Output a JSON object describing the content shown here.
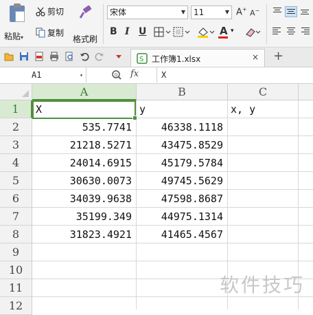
{
  "ribbon": {
    "paste_label": "粘贴",
    "cut_label": "剪切",
    "copy_label": "复制",
    "format_painter_label": "格式刷",
    "font_name": "宋体",
    "font_size": "11",
    "bold": "B",
    "italic": "I",
    "underline": "U",
    "grow_font": "A",
    "shrink_font": "A",
    "font_color_letter": "A"
  },
  "tabs": {
    "file_title": "工作簿1.xlsx",
    "close_symbol": "×",
    "new_tab_symbol": "+"
  },
  "formula_bar": {
    "cell_ref": "A1",
    "fx": "fx",
    "value": "X"
  },
  "sheet": {
    "columns": [
      "A",
      "B",
      "C"
    ],
    "rows": [
      "1",
      "2",
      "3",
      "4",
      "5",
      "6",
      "7",
      "8",
      "9",
      "10",
      "11",
      "12"
    ],
    "cells": {
      "A": [
        "X",
        "535.7741",
        "21218.5271",
        "24014.6915",
        "30630.0073",
        "34039.9638",
        "35199.349",
        "31823.4921"
      ],
      "B": [
        "y",
        "46338.1118",
        "43475.8529",
        "45179.5784",
        "49745.5629",
        "47598.8687",
        "44975.1314",
        "41465.4567"
      ],
      "C": [
        "x, y"
      ]
    }
  },
  "watermark": "软件技巧",
  "colors": {
    "selection_green": "#4f8f3d",
    "header_bg": "#f2f2f2",
    "selected_header_bg": "#d9ead3"
  }
}
